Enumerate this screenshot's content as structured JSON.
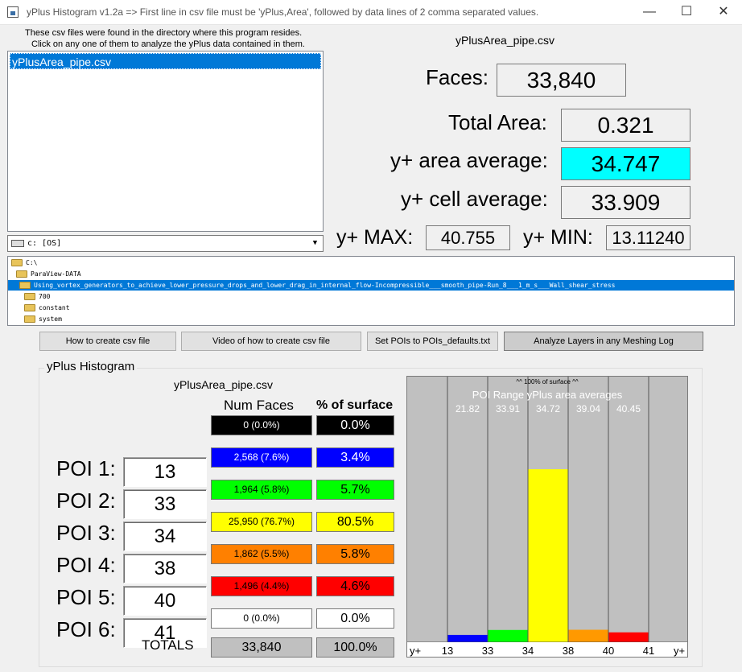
{
  "window": {
    "title": "yPlus Histogram v1.2a => First line in csv file must be 'yPlus,Area', followed by data lines of 2 comma separated values.",
    "minimize": "—",
    "maximize": "☐",
    "close": "✕"
  },
  "files": {
    "instructions_line1": "These csv files were found in the directory where this program resides.",
    "instructions_line2": "Click on any one of them to analyze the yPlus data contained in them.",
    "items": [
      "yPlusArea_pipe.csv"
    ],
    "drive": "c: [OS]"
  },
  "summary": {
    "filename": "yPlusArea_pipe.csv",
    "faces_label": "Faces:",
    "faces": "33,840",
    "total_area_label": "Total Area:",
    "total_area": "0.321",
    "area_avg_label": "y+ area average:",
    "area_avg": "34.747",
    "cell_avg_label": "y+ cell average:",
    "cell_avg": "33.909",
    "max_label": "y+ MAX:",
    "max": "40.755",
    "min_label": "y+ MIN:",
    "min": "13.11240",
    "highlight_color": "#00ffff"
  },
  "directories": [
    "C:\\",
    "ParaView-DATA",
    "Using_vortex_generators_to_achieve_lower_pressure_drops_and_lower_drag_in_internal_flow-Incompressible___smooth_pipe-Run_8___1_m_s___Wall_shear_stress",
    "700",
    "constant",
    "system"
  ],
  "buttons": {
    "how_to": "How to create csv file",
    "video": "Video of how to create csv file",
    "set_pois": "Set POIs to POIs_defaults.txt",
    "analyze": "Analyze Layers in any Meshing Log"
  },
  "histogram": {
    "group_title": "yPlus Histogram",
    "filename": "yPlusArea_pipe.csv",
    "col_faces": "Num Faces",
    "col_surface": "% of surface",
    "totals_label": "TOTALS",
    "totals_faces": "33,840",
    "totals_pct": "100.0%",
    "rows": [
      {
        "label": "",
        "poi": "",
        "faces": "0 (0.0%)",
        "pct": "0.0%",
        "bg": "#000000",
        "fg": "#ffffff"
      },
      {
        "label": "POI 1:",
        "poi": "13",
        "faces": "2,568 (7.6%)",
        "pct": "3.4%",
        "bg": "#0000ff",
        "fg": "#ffffff"
      },
      {
        "label": "POI 2:",
        "poi": "33",
        "faces": "1,964 (5.8%)",
        "pct": "5.7%",
        "bg": "#00ff00",
        "fg": "#000000"
      },
      {
        "label": "POI 3:",
        "poi": "34",
        "faces": "25,950 (76.7%)",
        "pct": "80.5%",
        "bg": "#ffff00",
        "fg": "#000000"
      },
      {
        "label": "POI 4:",
        "poi": "38",
        "faces": "1,862 (5.5%)",
        "pct": "5.8%",
        "bg": "#ff8000",
        "fg": "#000000"
      },
      {
        "label": "POI 5:",
        "poi": "40",
        "faces": "1,496 (4.4%)",
        "pct": "4.6%",
        "bg": "#ff0000",
        "fg": "#000000"
      },
      {
        "label": "POI 6:",
        "poi": "41",
        "faces": "0 (0.0%)",
        "pct": "0.0%",
        "bg": "#ffffff",
        "fg": "#000000"
      }
    ]
  },
  "chart_data": {
    "type": "bar",
    "top_label": "^^ 100% of surface ^^",
    "subtitle": "POI Range yPlus area averages",
    "range_averages": [
      "",
      "21.82",
      "33.91",
      "34.72",
      "39.04",
      "40.45",
      ""
    ],
    "x_tick_labels": [
      "y+",
      "13",
      "33",
      "34",
      "38",
      "40",
      "41",
      "y+"
    ],
    "values": [
      0.0,
      3.4,
      5.7,
      80.5,
      5.8,
      4.6,
      0.0
    ],
    "colors": [
      "#000000",
      "#0000ff",
      "#00ff00",
      "#ffff00",
      "#ff9900",
      "#ff0000",
      "#ffffff"
    ],
    "ylim": [
      0,
      100
    ]
  }
}
